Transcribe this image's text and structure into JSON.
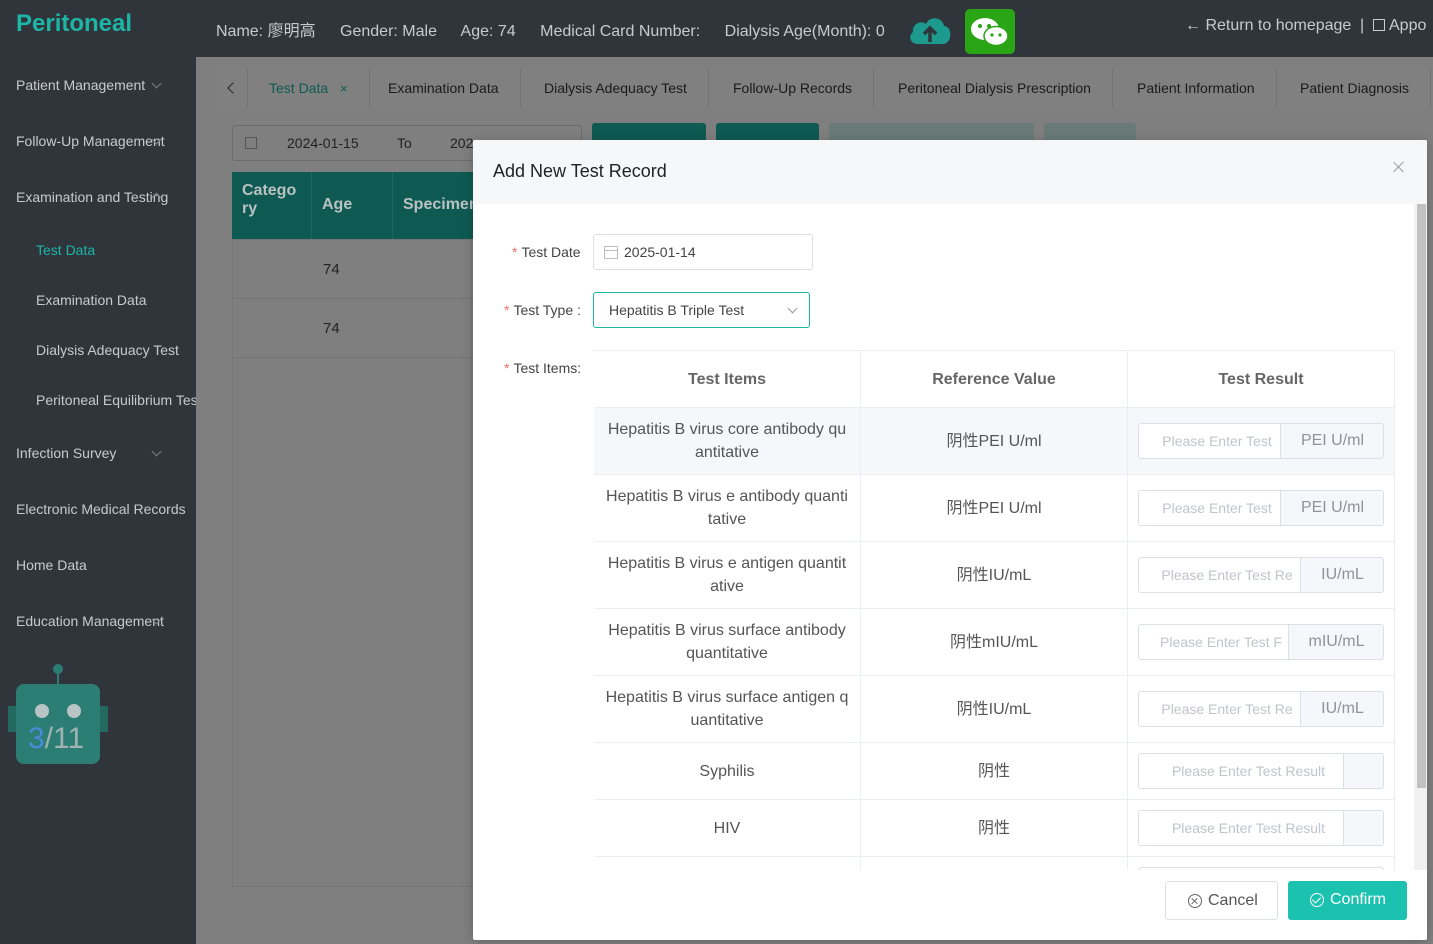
{
  "header": {
    "brand": "Peritoneal",
    "name": "Name: 廖明高",
    "gender": "Gender: Male",
    "age": "Age: 74",
    "medical_card": "Medical Card Number:",
    "dialysis_age": "Dialysis Age(Month): 0",
    "return_link": "← Return to homepage",
    "separator": "|",
    "appointment": "Appo"
  },
  "sidebar": {
    "items": [
      {
        "label": "Patient Management"
      },
      {
        "label": "Follow-Up Management"
      },
      {
        "label": "Examination and Testing"
      },
      {
        "label": "Test Data"
      },
      {
        "label": "Examination Data"
      },
      {
        "label": "Dialysis Adequacy Test"
      },
      {
        "label": "Peritoneal Equilibrium Tes"
      },
      {
        "label": "Infection Survey"
      },
      {
        "label": "Electronic Medical Records"
      },
      {
        "label": "Home Data"
      },
      {
        "label": "Education Management"
      }
    ],
    "assistant_counter_current": "3",
    "assistant_counter_total": "/11"
  },
  "tabs": [
    {
      "label": "Test Data",
      "close": "×"
    },
    {
      "label": "Examination Data"
    },
    {
      "label": "Dialysis Adequacy Test"
    },
    {
      "label": "Follow-Up Records"
    },
    {
      "label": "Peritoneal Dialysis Prescription"
    },
    {
      "label": "Patient Information"
    },
    {
      "label": "Patient Diagnosis"
    }
  ],
  "filter": {
    "start_date": "2024-01-15",
    "to": "To",
    "end_date_partial": "202"
  },
  "background_table": {
    "headers": [
      "Catego ry",
      "Age",
      "Specimen"
    ],
    "rows": [
      {
        "age": "74"
      },
      {
        "age": "74"
      }
    ]
  },
  "dialog": {
    "title": "Add New Test Record",
    "test_date_label": "Test Date",
    "test_date_value": "2025-01-14",
    "test_type_label": "Test Type :",
    "test_type_value": "Hepatitis B Triple Test",
    "test_items_label": "Test Items:",
    "columns": [
      "Test Items",
      "Reference Value",
      "Test Result"
    ],
    "items": [
      {
        "name": "Hepatitis B virus core antibody qu antitative",
        "reference": "阴性PEI U/ml",
        "placeholder": "Please Enter Test",
        "unit": "PEI U/ml"
      },
      {
        "name": "Hepatitis B virus e antibody quanti tative",
        "reference": "阴性PEI U/ml",
        "placeholder": "Please Enter Test",
        "unit": "PEI U/ml"
      },
      {
        "name": "Hepatitis B virus e antigen quantit ative",
        "reference": "阴性IU/mL",
        "placeholder": "Please Enter Test Re",
        "unit": "IU/mL"
      },
      {
        "name": "Hepatitis B virus surface antibody quantitative",
        "reference": "阴性mIU/mL",
        "placeholder": "Please Enter Test F",
        "unit": "mIU/mL"
      },
      {
        "name": "Hepatitis B virus surface antigen q uantitative",
        "reference": "阴性IU/mL",
        "placeholder": "Please Enter Test Re",
        "unit": "IU/mL"
      },
      {
        "name": "Syphilis",
        "reference": "阴性",
        "placeholder": "Please Enter Test Result",
        "unit": ""
      },
      {
        "name": "HIV",
        "reference": "阴性",
        "placeholder": "Please Enter Test Result",
        "unit": ""
      }
    ],
    "cancel_label": "Cancel",
    "confirm_label": "Confirm"
  },
  "colors": {
    "accent": "#1cb5a6",
    "confirm": "#1cc2b0",
    "sidebar_bg": "#30353b",
    "required": "#f56c6c"
  }
}
